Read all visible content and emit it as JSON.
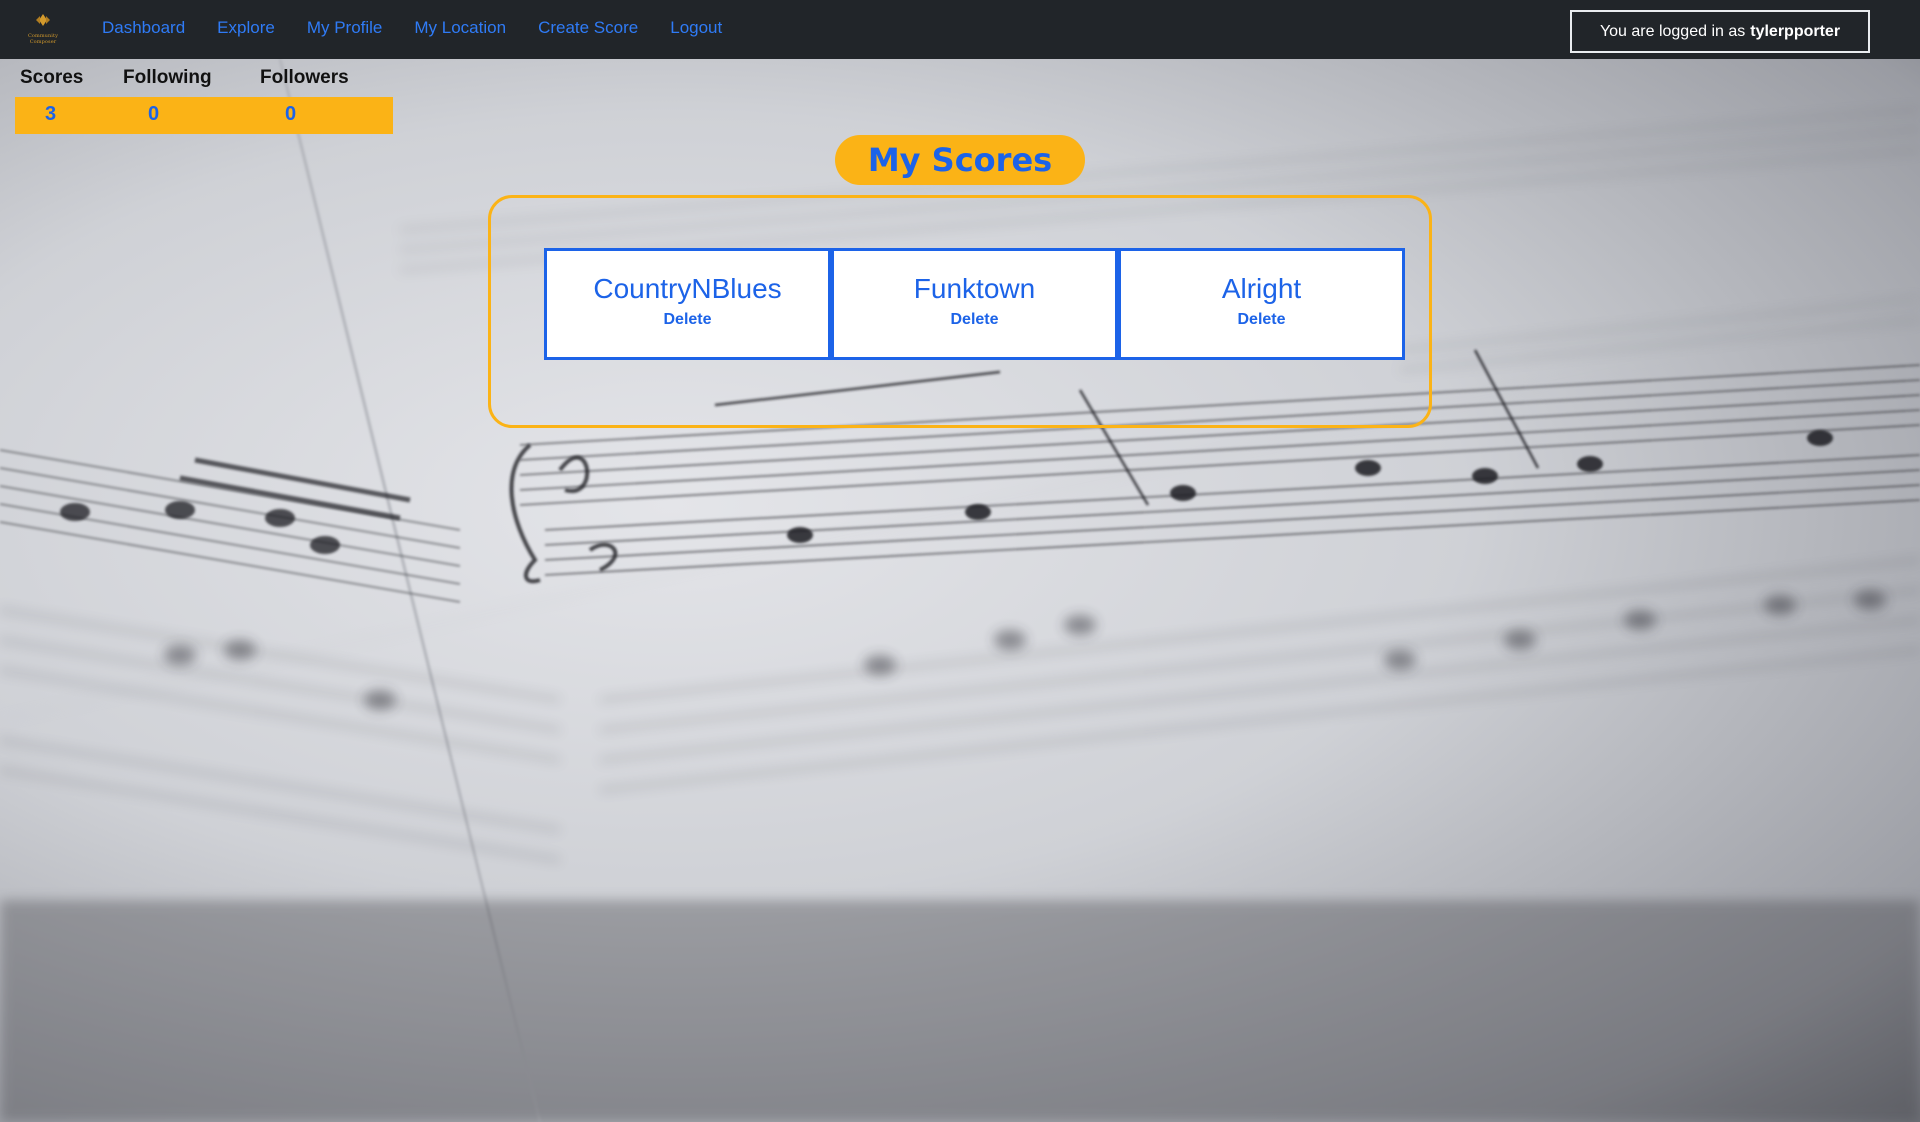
{
  "brand": {
    "text": "Community Composer"
  },
  "nav": {
    "links": [
      "Dashboard",
      "Explore",
      "My Profile",
      "My Location",
      "Create Score",
      "Logout"
    ]
  },
  "login": {
    "prefix": "You are logged in as",
    "username": "tylerpporter"
  },
  "stats": {
    "headers": [
      "Scores",
      "Following",
      "Followers"
    ],
    "values": [
      "3",
      "0",
      "0"
    ]
  },
  "section": {
    "title": "My Scores"
  },
  "scores": [
    {
      "title": "CountryNBlues",
      "delete_label": "Delete"
    },
    {
      "title": "Funktown",
      "delete_label": "Delete"
    },
    {
      "title": "Alright",
      "delete_label": "Delete"
    }
  ],
  "colors": {
    "navbar": "#212529",
    "link": "#2f7bf6",
    "accent": "#fbb316",
    "primary": "#1c63e8"
  }
}
